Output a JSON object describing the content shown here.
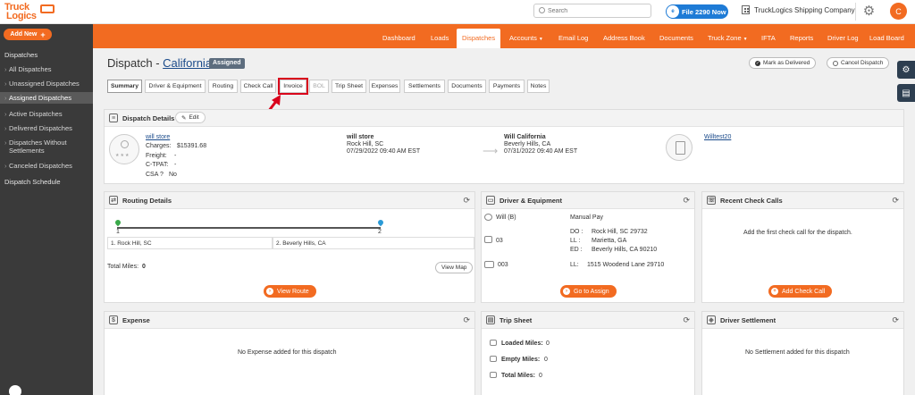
{
  "topbar": {
    "logo_line1": "Truck",
    "logo_line2": "Logics",
    "search_placeholder": "Search",
    "file2290_badge": "e",
    "file2290_label": "File 2290 Now",
    "company_name": "TruckLogics Shipping Company",
    "avatar_initial": "C"
  },
  "sidebar": {
    "add_new_label": "Add New",
    "section_title": "Dispatches",
    "items": [
      {
        "label": "All Dispatches"
      },
      {
        "label": "Unassigned Dispatches"
      },
      {
        "label": "Assigned Dispatches",
        "active": true
      },
      {
        "label": "Active Dispatches"
      },
      {
        "label": "Delivered Dispatches"
      },
      {
        "label": "Dispatches Without"
      },
      {
        "label": "Settlements"
      },
      {
        "label": "Canceled Dispatches"
      }
    ],
    "schedule_label": "Dispatch Schedule"
  },
  "mainnav": {
    "items": [
      "Dashboard",
      "Loads",
      "Dispatches",
      "Accounts",
      "Email Log",
      "Address Book",
      "Documents",
      "Truck Zone",
      "IFTA",
      "Reports",
      "Driver Log",
      "Load Board"
    ],
    "active": "Dispatches"
  },
  "header": {
    "title_prefix": "Dispatch - ",
    "title_link": "California",
    "status_badge": "Assigned",
    "mark_delivered_label": "Mark as Delivered",
    "cancel_dispatch_label": "Cancel Dispatch"
  },
  "tabs": [
    {
      "label": "Summary"
    },
    {
      "label": "Driver & Equipment"
    },
    {
      "label": "Routing"
    },
    {
      "label": "Check Call"
    },
    {
      "label": "Invoice"
    },
    {
      "label": "BOL"
    },
    {
      "label": "Trip Sheet"
    },
    {
      "label": "Expenses"
    },
    {
      "label": "Settlements"
    },
    {
      "label": "Documents"
    },
    {
      "label": "Payments"
    },
    {
      "label": "Notes"
    }
  ],
  "dispatch_details": {
    "title": "Dispatch Details",
    "edit_label": "Edit",
    "customer_name": "will store",
    "charges_label": "Charges:",
    "charges_value": "$15391.68",
    "freight_label": "Freight:",
    "freight_value": "-",
    "ctpat_label": "C-TPAT:",
    "ctpat_value": "-",
    "csa_label": "CSA ?",
    "csa_value": "No",
    "origin_name": "will store",
    "origin_city": "Rock Hill, SC",
    "origin_date": "07/29/2022 09:40 AM EST",
    "dest_name": "Will California",
    "dest_city": "Beverly Hills, CA",
    "dest_date": "07/31/2022 09:40 AM EST",
    "doc_link": "Willtest20"
  },
  "routing": {
    "title": "Routing Details",
    "stop1_num": "1",
    "stop2_num": "2",
    "stop1": "1. Rock Hill, SC",
    "stop2": "2. Beverly Hills, CA",
    "total_miles_label": "Total Miles:",
    "total_miles_value": "0",
    "view_map_label": "View Map",
    "view_route_label": "View Route"
  },
  "driver_equipment": {
    "title": "Driver & Equipment",
    "driver": "Will (B)",
    "pay_type": "Manual Pay",
    "truck": "03",
    "do_label": "DO :",
    "do_value": "Rock Hill, SC 29732",
    "ll_label": "LL :",
    "ll_value": "Marietta, GA",
    "ed_label": "ED :",
    "ed_value": "Beverly Hills, CA 90210",
    "trailer": "003",
    "ll2_label": "LL:",
    "ll2_value": "1515 Woodend Lane 29710",
    "go_assign_label": "Go to Assign"
  },
  "check_calls": {
    "title": "Recent Check Calls",
    "empty_text": "Add the first check call for the dispatch.",
    "add_label": "Add Check Call"
  },
  "expense": {
    "title": "Expense",
    "empty_text": "No Expense added for this dispatch"
  },
  "trip_sheet": {
    "title": "Trip Sheet",
    "loaded_label": "Loaded Miles:",
    "loaded_value": "0",
    "empty_label": "Empty Miles:",
    "empty_value": "0",
    "total_label": "Total Miles:",
    "total_value": "0"
  },
  "driver_settlement": {
    "title": "Driver Settlement",
    "empty_text": "No Settlement added for this dispatch"
  },
  "colors": {
    "brand_orange": "#f26b21",
    "sidebar_bg": "#3a3a3a",
    "highlight_red": "#d9001b",
    "link_blue": "#1a4a8a"
  }
}
